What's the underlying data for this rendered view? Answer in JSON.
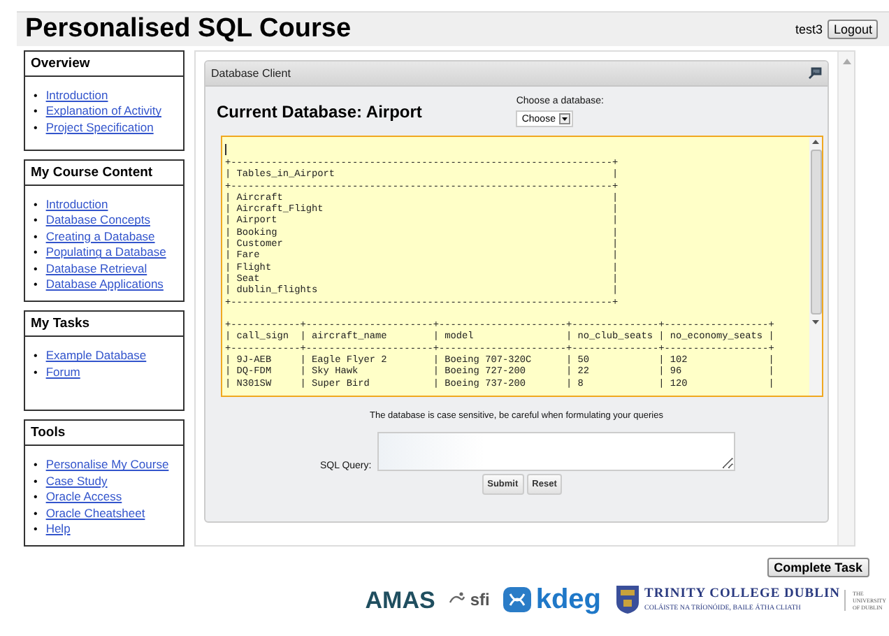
{
  "header": {
    "title": "Personalised SQL Course",
    "username": "test3",
    "logout_button": "Logout"
  },
  "sidebar": [
    {
      "title": "Overview",
      "marker": "•",
      "links": [
        "Introduction",
        "Explanation of Activity",
        "Project Specification"
      ]
    },
    {
      "title": "My Course Content",
      "marker": "•",
      "links": [
        "Introduction",
        "Database Concepts",
        "Creating a Database",
        "Populating a Database",
        "Database Retrieval",
        "Database Applications"
      ]
    },
    {
      "title": "My Tasks",
      "marker": "•",
      "links": [
        "Example Database",
        "Forum"
      ]
    },
    {
      "title": "Tools",
      "marker": "•",
      "links": [
        "Personalise My Course",
        "Case Study",
        "Oracle Access",
        "Oracle Cheatsheet",
        "Help"
      ]
    }
  ],
  "panel": {
    "title": "Database Client",
    "heading": "Current Database: Airport",
    "database_select": {
      "label": "Choose a database:",
      "value": "Choose"
    },
    "output_lines": [
      "+------------------------------------------------------------------+",
      "| Tables_in_Airport                                                |",
      "+------------------------------------------------------------------+",
      "| Aircraft                                                         |",
      "| Aircraft_Flight                                                  |",
      "| Airport                                                          |",
      "| Booking                                                          |",
      "| Customer                                                         |",
      "| Fare                                                             |",
      "| Flight                                                           |",
      "| Seat                                                             |",
      "| dublin_flights                                                   |",
      "+------------------------------------------------------------------+",
      "+------------+----------------------+----------------------+---------------+------------------+",
      "| call_sign  | aircraft_name        | model                | no_club_seats | no_economy_seats |",
      "+------------+----------------------+----------------------+---------------+------------------+",
      "| 9J-AEB     | Eagle Flyer 2        | Boeing 707-320C      | 50            | 102              |",
      "| DQ-FDM     | Sky Hawk             | Boeing 727-200       | 22            | 96               |",
      "| N301SW     | Super Bird           | Boeing 737-200       | 8             | 120              |"
    ],
    "notice": "The database is case sensitive, be careful when formulating your queries",
    "query_label": "SQL Query:",
    "buttons": [
      "Submit",
      "Reset"
    ]
  },
  "complete_button": "Complete Task",
  "logos": [
    {
      "kind": "amas",
      "text": "AMAS"
    },
    {
      "kind": "sfi",
      "text": "sfi"
    },
    {
      "kind": "kdeg",
      "text": "kdeg"
    },
    {
      "kind": "tcd",
      "lines": [
        "TRINITY COLLEGE DUBLIN",
        "COLÁISTE NA TRÍONÓIDE, BAILE ÁTHA CLIATH"
      ],
      "aside": [
        "THE",
        "UNIVERSITY",
        "OF DUBLIN"
      ]
    }
  ]
}
